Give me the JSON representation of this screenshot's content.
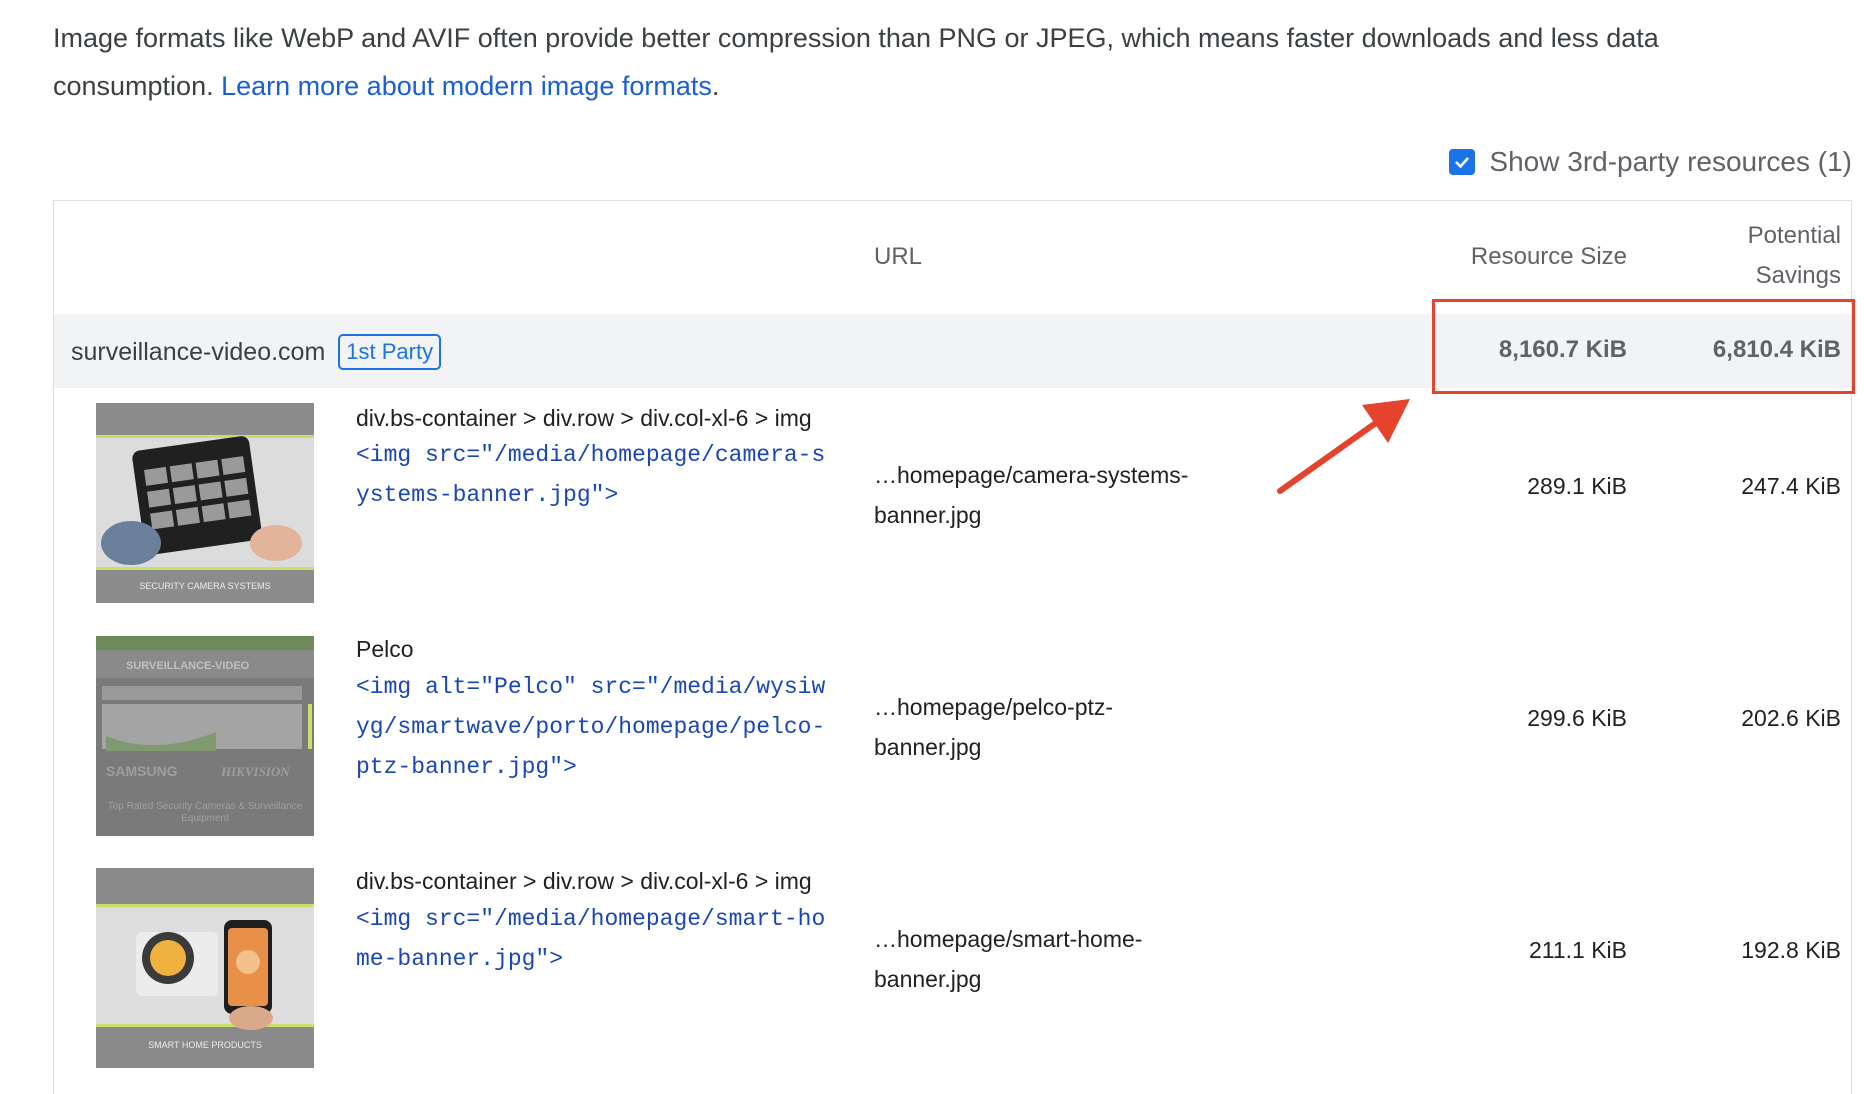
{
  "description": {
    "text": "Image formats like WebP and AVIF often provide better compression than PNG or JPEG, which means faster downloads and less data consumption.",
    "link": "Learn more about modern image formats",
    "end": "."
  },
  "toggle": {
    "label": "Show 3rd-party resources (1)",
    "checked": true
  },
  "table": {
    "headers": {
      "url": "URL",
      "size": "Resource Size",
      "savings_line1": "Potential",
      "savings_line2": "Savings"
    },
    "group": {
      "name": "surveillance-video.com",
      "badge": "1st Party",
      "size": "8,160.7 KiB",
      "savings": "6,810.4 KiB"
    },
    "rows": [
      {
        "label": "div.bs-container > div.row > div.col-xl-6 > img",
        "code": "<img src=\"/media/homepage/camera-systems-banner.jpg\">",
        "url_line1": "…homepage/camera-systems-",
        "url_line2": "banner.jpg",
        "size": "289.1 KiB",
        "savings": "247.4 KiB",
        "thumb_caption": "SECURITY CAMERA SYSTEMS"
      },
      {
        "label": "Pelco",
        "code": "<img alt=\"Pelco\" src=\"/media/wysiwyg/smartwave/porto/homepage/pelco-ptz-banner.jpg\">",
        "url_line1": "…homepage/pelco-ptz-",
        "url_line2": "banner.jpg",
        "size": "299.6 KiB",
        "savings": "202.6 KiB",
        "thumb_brand": "SURVEILLANCE-VIDEO",
        "thumb_logo1": "SAMSUNG",
        "thumb_logo2": "HIKVISION",
        "thumb_caption": "Top Rated Security Cameras & Surveillance Equipment"
      },
      {
        "label": "div.bs-container > div.row > div.col-xl-6 > img",
        "code": "<img src=\"/media/homepage/smart-home-banner.jpg\">",
        "url_line1": "…homepage/smart-home-",
        "url_line2": "banner.jpg",
        "size": "211.1 KiB",
        "savings": "192.8 KiB",
        "thumb_caption": "SMART HOME PRODUCTS"
      }
    ]
  },
  "colors": {
    "link": "#1a5fd8",
    "accent": "#1a73e8",
    "annotation": "#e5432d",
    "code": "#1a47b3"
  }
}
